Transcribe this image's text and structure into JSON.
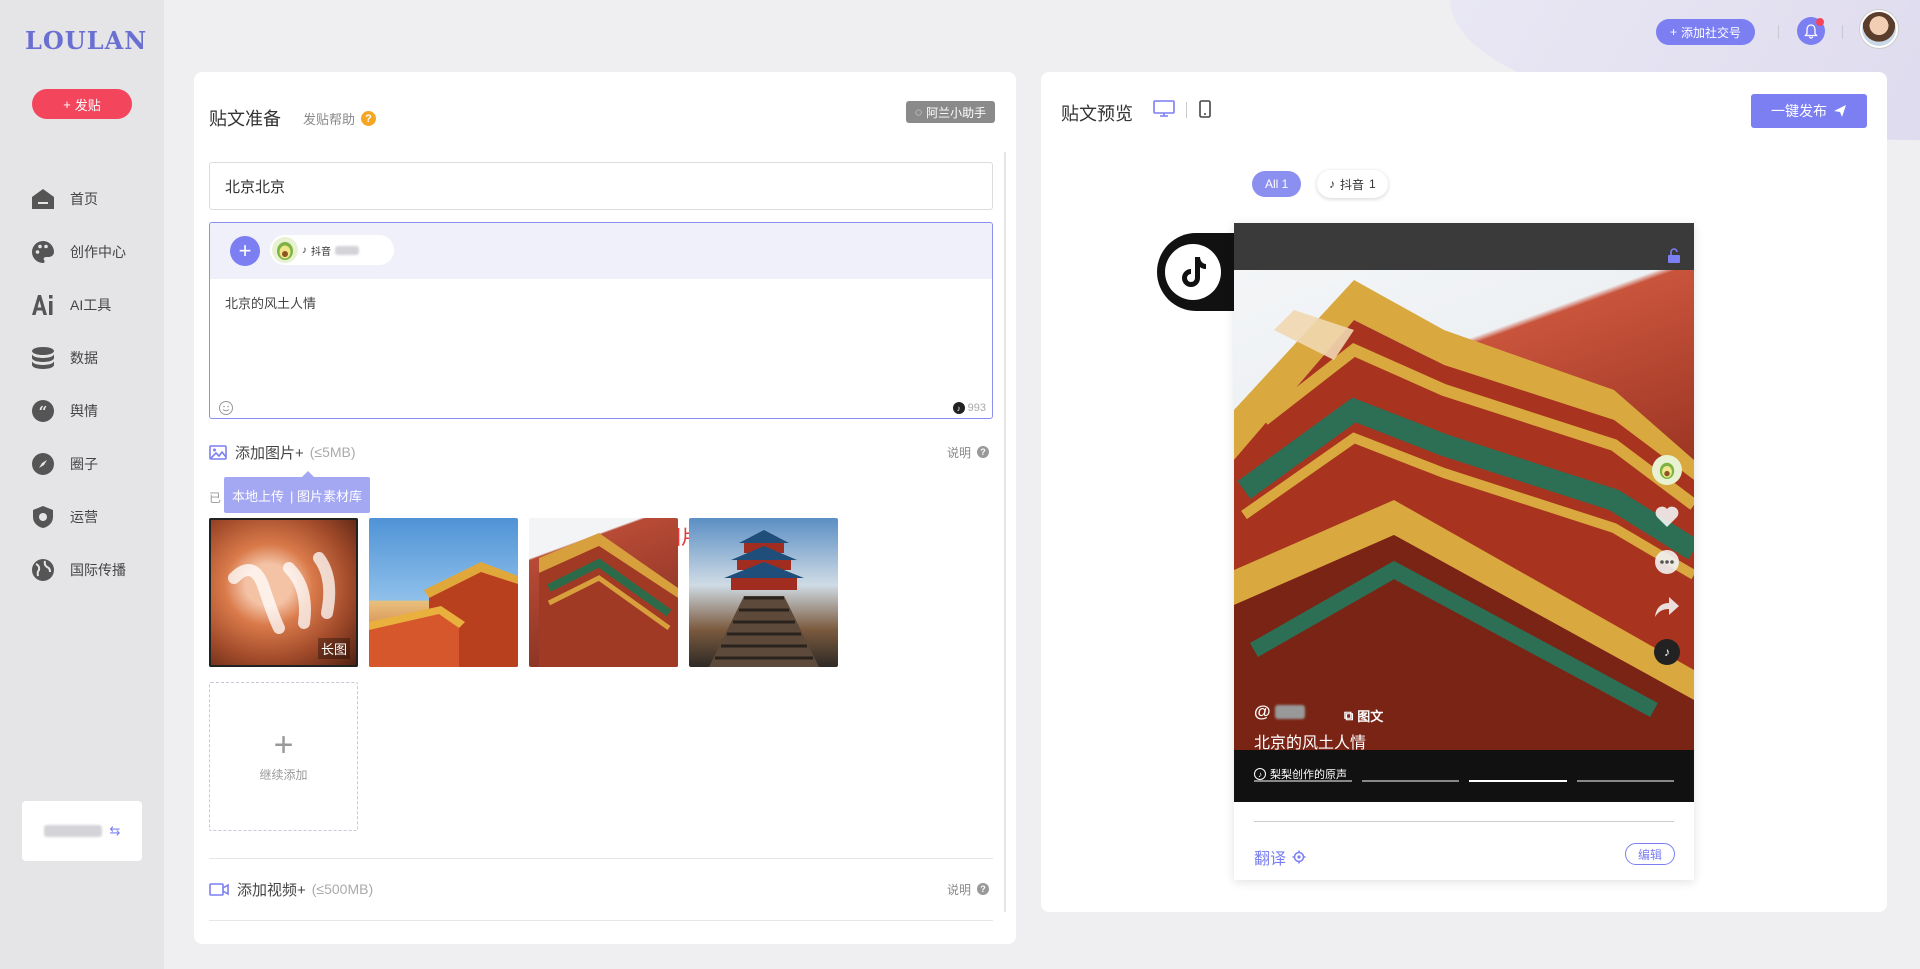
{
  "app": {
    "logo": "LOULAN"
  },
  "sidebar": {
    "post_button": "发贴",
    "items": [
      {
        "label": "首页",
        "icon": "home-icon"
      },
      {
        "label": "创作中心",
        "icon": "palette-icon"
      },
      {
        "label": "AI工具",
        "icon": "ai-icon"
      },
      {
        "label": "数据",
        "icon": "database-icon"
      },
      {
        "label": "舆情",
        "icon": "quote-icon"
      },
      {
        "label": "圈子",
        "icon": "compass-icon"
      },
      {
        "label": "运营",
        "icon": "shield-icon"
      },
      {
        "label": "国际传播",
        "icon": "globe-icon"
      }
    ]
  },
  "topbar": {
    "add_account": "添加社交号"
  },
  "editor": {
    "title": "贴文准备",
    "help": "发贴帮助",
    "help_icon": "?",
    "assistant": "阿兰小助手",
    "title_value": "北京北京",
    "platform_label": "抖音",
    "body_text": "北京的风土人情",
    "char_count": "993",
    "images": {
      "label": "添加图片+",
      "limit": "(≤5MB)",
      "explain": "说明",
      "already_prefix": "已",
      "popover_local": "本地上传",
      "popover_library": "| 图片素材库",
      "annotation": "上传图片素材",
      "long_image_tag": "长图",
      "add_more": "继续添加"
    },
    "video": {
      "label": "添加视频+",
      "limit": "(≤500MB)",
      "explain": "说明"
    }
  },
  "preview": {
    "title": "贴文预览",
    "publish": "一键发布",
    "filter_all": "All 1",
    "filter_douyin": "抖音",
    "filter_douyin_count": "1",
    "author": "@",
    "tuwen": "图文",
    "caption": "北京的风土人情",
    "music": "梨梨创作的原声",
    "translate": "翻译",
    "edit": "编辑"
  },
  "colors": {
    "accent": "#7b7ff2",
    "danger": "#f3465d",
    "annotation": "#e53935"
  }
}
